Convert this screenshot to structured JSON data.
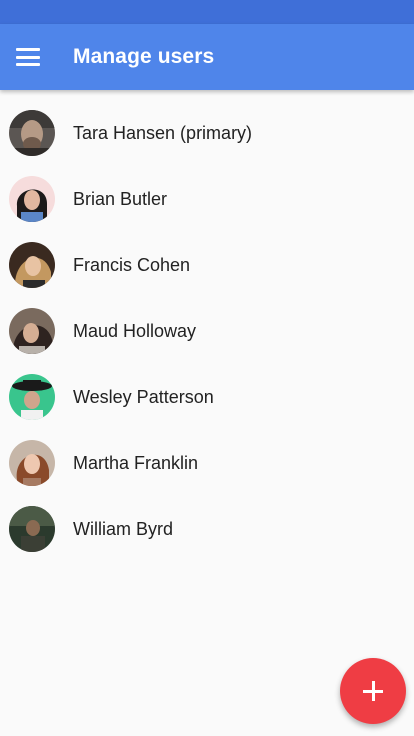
{
  "colors": {
    "status_bar": "#3f6fd8",
    "app_bar": "#4f85ea",
    "fab": "#ef3d44",
    "background": "#fafafa"
  },
  "app_bar": {
    "menu_icon": "menu-icon",
    "title": "Manage users"
  },
  "users": [
    {
      "name": "Tara Hansen (primary)",
      "avatar": "avatar-photo"
    },
    {
      "name": "Brian Butler",
      "avatar": "avatar-photo"
    },
    {
      "name": "Francis Cohen",
      "avatar": "avatar-photo"
    },
    {
      "name": "Maud Holloway",
      "avatar": "avatar-photo"
    },
    {
      "name": "Wesley Patterson",
      "avatar": "avatar-photo"
    },
    {
      "name": "Martha Franklin",
      "avatar": "avatar-photo"
    },
    {
      "name": "William Byrd",
      "avatar": "avatar-photo"
    }
  ],
  "fab": {
    "icon": "plus-icon"
  }
}
